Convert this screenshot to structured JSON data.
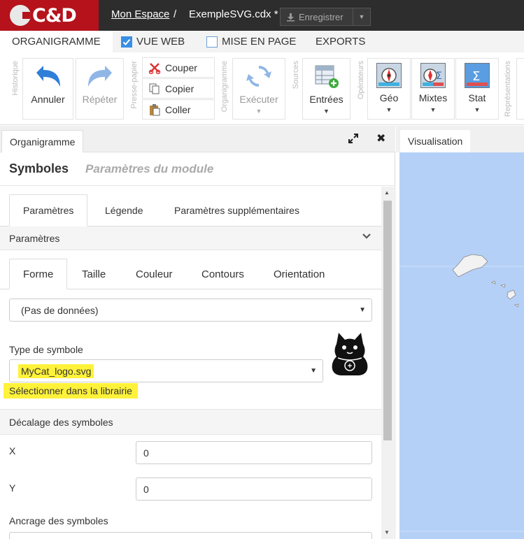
{
  "topbar": {
    "logo_text": "C&D",
    "espace_link": "Mon Espace",
    "separator": "/",
    "file_name": "ExempleSVG.cdx *",
    "save_label": "Enregistrer"
  },
  "ribbon_tabs": [
    {
      "label": "ORGANIGRAMME",
      "active": true
    },
    {
      "label": "VUE WEB",
      "checked": true
    },
    {
      "label": "MISE EN PAGE",
      "checked": false
    },
    {
      "label": "EXPORTS"
    }
  ],
  "ribbon": {
    "groups": [
      "Historique",
      "Presse-papier",
      "Organigramme",
      "Sources",
      "Opérateurs",
      "Représentations"
    ],
    "undo_label": "Annuler",
    "redo_label": "Répéter",
    "cut_label": "Couper",
    "copy_label": "Copier",
    "paste_label": "Coller",
    "execute_label": "Exécuter",
    "inputs_label": "Entrées",
    "geo_label": "Géo",
    "mixed_label": "Mixtes",
    "stat_label": "Stat"
  },
  "left_panel": {
    "tab_label": "Organigramme",
    "title": "Symboles",
    "subtitle": "Paramètres du module",
    "tabs": [
      "Paramètres",
      "Légende",
      "Paramètres supplémentaires"
    ],
    "section_params": "Paramètres",
    "subtabs": [
      "Forme",
      "Taille",
      "Couleur",
      "Contours",
      "Orientation"
    ],
    "data_select_value": "(Pas de données)",
    "symbol_type_label": "Type de symbole",
    "symbol_type_value": "MyCat_logo.svg",
    "library_link": "Sélectionner dans la librairie",
    "offset_section": "Décalage des symboles",
    "x_label": "X",
    "x_value": "0",
    "y_label": "Y",
    "y_value": "0",
    "anchor_label": "Ancrage des symboles"
  },
  "right_panel": {
    "tab_label": "Visualisation"
  },
  "colors": {
    "brand_red": "#b5121b",
    "topbar_bg": "#2d2d2d",
    "highlight": "#fff23a",
    "map_water": "#b5d0f7",
    "accent_blue": "#3a8ee6"
  }
}
